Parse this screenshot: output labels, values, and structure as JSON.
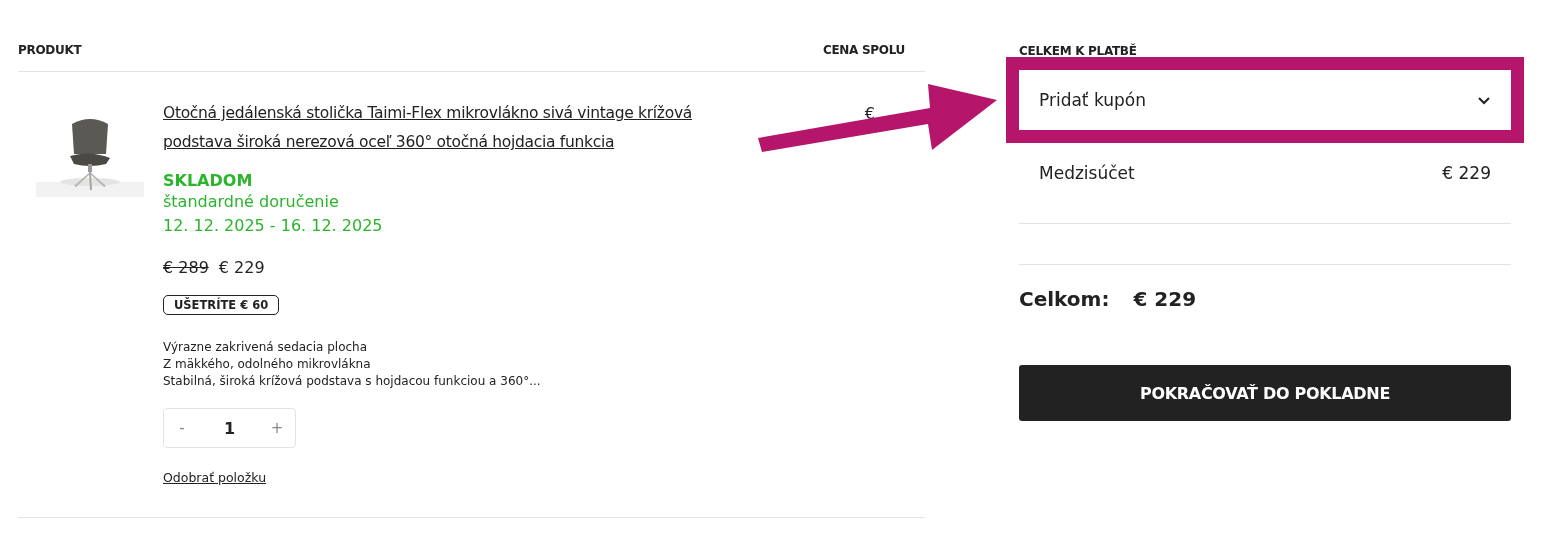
{
  "cart": {
    "columns": [
      "PRODUKT",
      "CENA SPOLU"
    ],
    "items": [
      {
        "title": "Otočná jedálenská stolička Taimi-Flex mikrovlákno sivá vintage krížová podstava široká nerezová oceľ 360° otočná hojdacia funkcia",
        "stock": "SKLADOM",
        "delivery": "štandardné doručenie",
        "delivery_dates": "12. 12. 2025 - 16. 12. 2025",
        "old_price": "€ 289",
        "price": "€ 229",
        "savings_badge": "UŠETRÍTE € 60",
        "features": [
          "Výrazne zakrivená sedacia plocha",
          "Z mäkkého, odolného mikrovlákna",
          "Stabilná, široká krížová podstava s hojdacou funkciou a 360°..."
        ],
        "quantity": {
          "minus": "-",
          "value": "1",
          "plus": "+"
        },
        "remove_link": "Odobrať položku",
        "total": "€"
      }
    ]
  },
  "summary": {
    "title": "CELKEM K PLATBĚ",
    "coupon": {
      "label": "Pridať kupón",
      "expanded": false,
      "highlighted": true
    },
    "subtotal": {
      "label": "Medzisúčet",
      "value": "€ 229"
    },
    "total": {
      "label": "Celkom:",
      "value": "€ 229"
    },
    "checkout_button": "POKRAČOVAŤ DO POKLADNE"
  },
  "annotation": {
    "kind": "arrow",
    "color": "#b5166b"
  }
}
